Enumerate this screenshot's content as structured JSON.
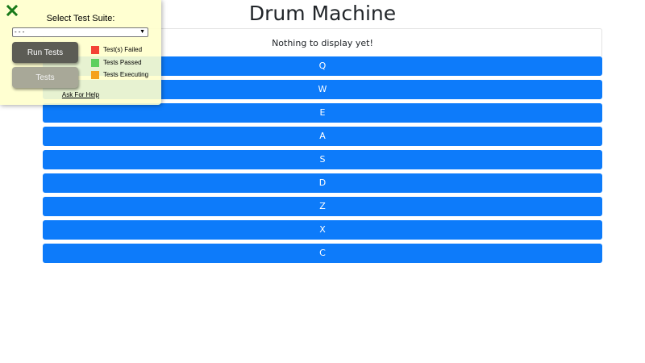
{
  "app": {
    "title": "Drum Machine"
  },
  "display": {
    "text": "Nothing to display yet!"
  },
  "pads": [
    {
      "key": "Q"
    },
    {
      "key": "W"
    },
    {
      "key": "E"
    },
    {
      "key": "A"
    },
    {
      "key": "S"
    },
    {
      "key": "D"
    },
    {
      "key": "Z"
    },
    {
      "key": "X"
    },
    {
      "key": "C"
    }
  ],
  "test_panel": {
    "close_icon": "close-x-icon",
    "suite_label": "Select Test Suite:",
    "suite_selected": "- - -",
    "run_tests_label": "Run Tests",
    "tests_label": "Tests",
    "legend": {
      "failed": "Test(s) Failed",
      "passed": "Tests Passed",
      "executing": "Tests Executing"
    },
    "help_label": "Ask For Help"
  },
  "colors": {
    "pad_blue": "#0d7bfa",
    "panel_yellow": "#ffffcc",
    "failed": "#f44336",
    "passed": "#5ed05e",
    "executing": "#f5a21a",
    "close_green": "#1a7a1a"
  }
}
